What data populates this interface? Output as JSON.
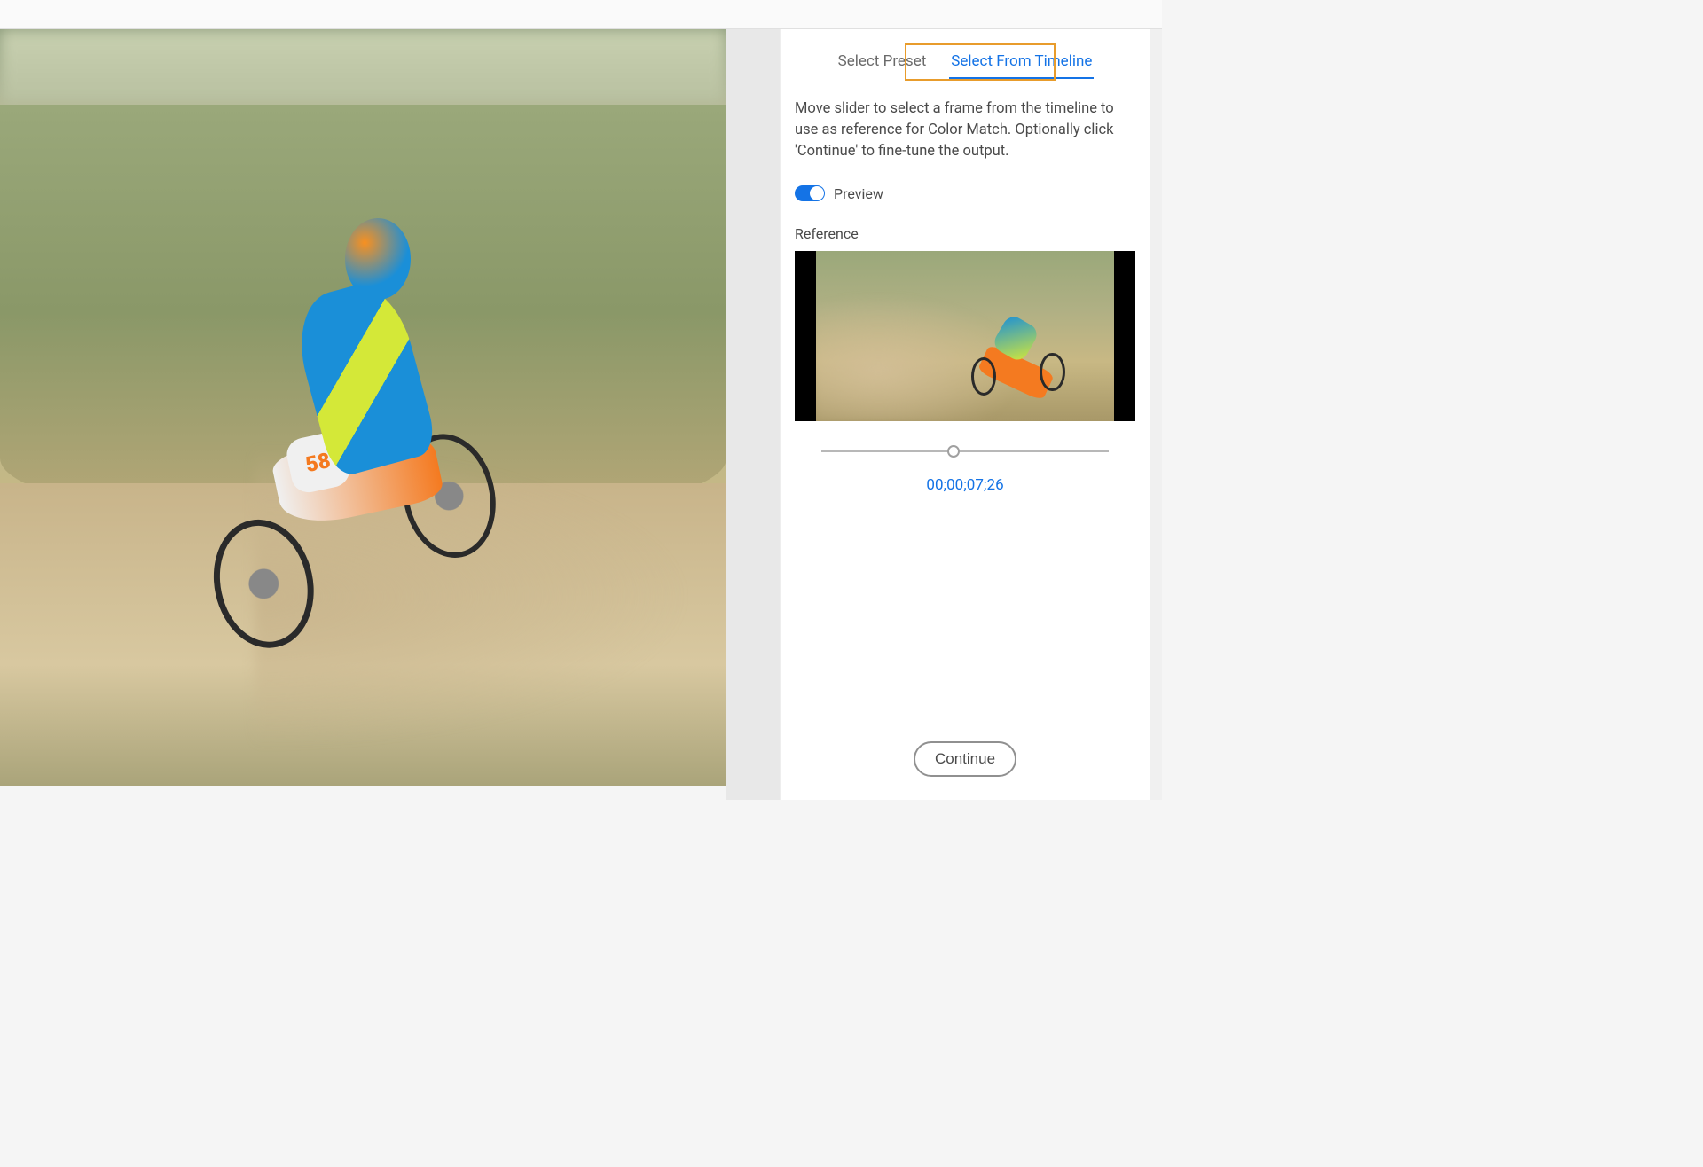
{
  "tabs": {
    "preset": "Select Preset",
    "timeline": "Select From Timeline"
  },
  "instruction": "Move slider to select a frame from the timeline to use as reference for Color Match. Optionally click 'Continue' to fine-tune the output.",
  "preview_toggle": {
    "label": "Preview",
    "on": true
  },
  "reference": {
    "label": "Reference"
  },
  "slider": {
    "position_percent": 46,
    "timecode": "00;00;07;26"
  },
  "buttons": {
    "continue": "Continue"
  },
  "bike_number": "58"
}
